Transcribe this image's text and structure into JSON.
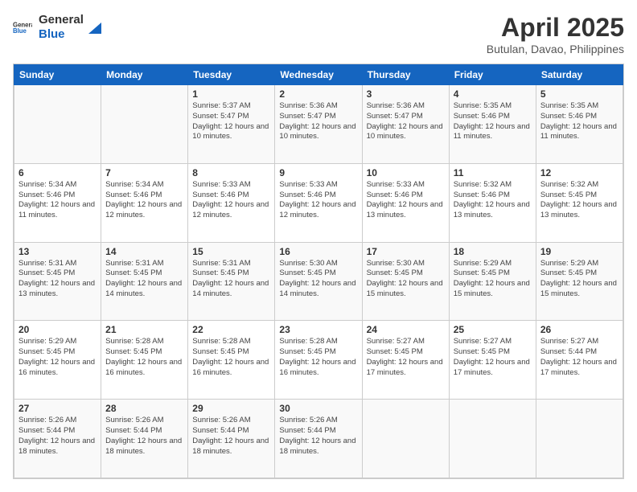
{
  "header": {
    "logo_line1": "General",
    "logo_line2": "Blue",
    "main_title": "April 2025",
    "subtitle": "Butulan, Davao, Philippines"
  },
  "calendar": {
    "days_of_week": [
      "Sunday",
      "Monday",
      "Tuesday",
      "Wednesday",
      "Thursday",
      "Friday",
      "Saturday"
    ],
    "weeks": [
      [
        {
          "day": "",
          "info": ""
        },
        {
          "day": "",
          "info": ""
        },
        {
          "day": "1",
          "info": "Sunrise: 5:37 AM\nSunset: 5:47 PM\nDaylight: 12 hours and 10 minutes."
        },
        {
          "day": "2",
          "info": "Sunrise: 5:36 AM\nSunset: 5:47 PM\nDaylight: 12 hours and 10 minutes."
        },
        {
          "day": "3",
          "info": "Sunrise: 5:36 AM\nSunset: 5:47 PM\nDaylight: 12 hours and 10 minutes."
        },
        {
          "day": "4",
          "info": "Sunrise: 5:35 AM\nSunset: 5:46 PM\nDaylight: 12 hours and 11 minutes."
        },
        {
          "day": "5",
          "info": "Sunrise: 5:35 AM\nSunset: 5:46 PM\nDaylight: 12 hours and 11 minutes."
        }
      ],
      [
        {
          "day": "6",
          "info": "Sunrise: 5:34 AM\nSunset: 5:46 PM\nDaylight: 12 hours and 11 minutes."
        },
        {
          "day": "7",
          "info": "Sunrise: 5:34 AM\nSunset: 5:46 PM\nDaylight: 12 hours and 12 minutes."
        },
        {
          "day": "8",
          "info": "Sunrise: 5:33 AM\nSunset: 5:46 PM\nDaylight: 12 hours and 12 minutes."
        },
        {
          "day": "9",
          "info": "Sunrise: 5:33 AM\nSunset: 5:46 PM\nDaylight: 12 hours and 12 minutes."
        },
        {
          "day": "10",
          "info": "Sunrise: 5:33 AM\nSunset: 5:46 PM\nDaylight: 12 hours and 13 minutes."
        },
        {
          "day": "11",
          "info": "Sunrise: 5:32 AM\nSunset: 5:46 PM\nDaylight: 12 hours and 13 minutes."
        },
        {
          "day": "12",
          "info": "Sunrise: 5:32 AM\nSunset: 5:45 PM\nDaylight: 12 hours and 13 minutes."
        }
      ],
      [
        {
          "day": "13",
          "info": "Sunrise: 5:31 AM\nSunset: 5:45 PM\nDaylight: 12 hours and 13 minutes."
        },
        {
          "day": "14",
          "info": "Sunrise: 5:31 AM\nSunset: 5:45 PM\nDaylight: 12 hours and 14 minutes."
        },
        {
          "day": "15",
          "info": "Sunrise: 5:31 AM\nSunset: 5:45 PM\nDaylight: 12 hours and 14 minutes."
        },
        {
          "day": "16",
          "info": "Sunrise: 5:30 AM\nSunset: 5:45 PM\nDaylight: 12 hours and 14 minutes."
        },
        {
          "day": "17",
          "info": "Sunrise: 5:30 AM\nSunset: 5:45 PM\nDaylight: 12 hours and 15 minutes."
        },
        {
          "day": "18",
          "info": "Sunrise: 5:29 AM\nSunset: 5:45 PM\nDaylight: 12 hours and 15 minutes."
        },
        {
          "day": "19",
          "info": "Sunrise: 5:29 AM\nSunset: 5:45 PM\nDaylight: 12 hours and 15 minutes."
        }
      ],
      [
        {
          "day": "20",
          "info": "Sunrise: 5:29 AM\nSunset: 5:45 PM\nDaylight: 12 hours and 16 minutes."
        },
        {
          "day": "21",
          "info": "Sunrise: 5:28 AM\nSunset: 5:45 PM\nDaylight: 12 hours and 16 minutes."
        },
        {
          "day": "22",
          "info": "Sunrise: 5:28 AM\nSunset: 5:45 PM\nDaylight: 12 hours and 16 minutes."
        },
        {
          "day": "23",
          "info": "Sunrise: 5:28 AM\nSunset: 5:45 PM\nDaylight: 12 hours and 16 minutes."
        },
        {
          "day": "24",
          "info": "Sunrise: 5:27 AM\nSunset: 5:45 PM\nDaylight: 12 hours and 17 minutes."
        },
        {
          "day": "25",
          "info": "Sunrise: 5:27 AM\nSunset: 5:45 PM\nDaylight: 12 hours and 17 minutes."
        },
        {
          "day": "26",
          "info": "Sunrise: 5:27 AM\nSunset: 5:44 PM\nDaylight: 12 hours and 17 minutes."
        }
      ],
      [
        {
          "day": "27",
          "info": "Sunrise: 5:26 AM\nSunset: 5:44 PM\nDaylight: 12 hours and 18 minutes."
        },
        {
          "day": "28",
          "info": "Sunrise: 5:26 AM\nSunset: 5:44 PM\nDaylight: 12 hours and 18 minutes."
        },
        {
          "day": "29",
          "info": "Sunrise: 5:26 AM\nSunset: 5:44 PM\nDaylight: 12 hours and 18 minutes."
        },
        {
          "day": "30",
          "info": "Sunrise: 5:26 AM\nSunset: 5:44 PM\nDaylight: 12 hours and 18 minutes."
        },
        {
          "day": "",
          "info": ""
        },
        {
          "day": "",
          "info": ""
        },
        {
          "day": "",
          "info": ""
        }
      ]
    ]
  }
}
